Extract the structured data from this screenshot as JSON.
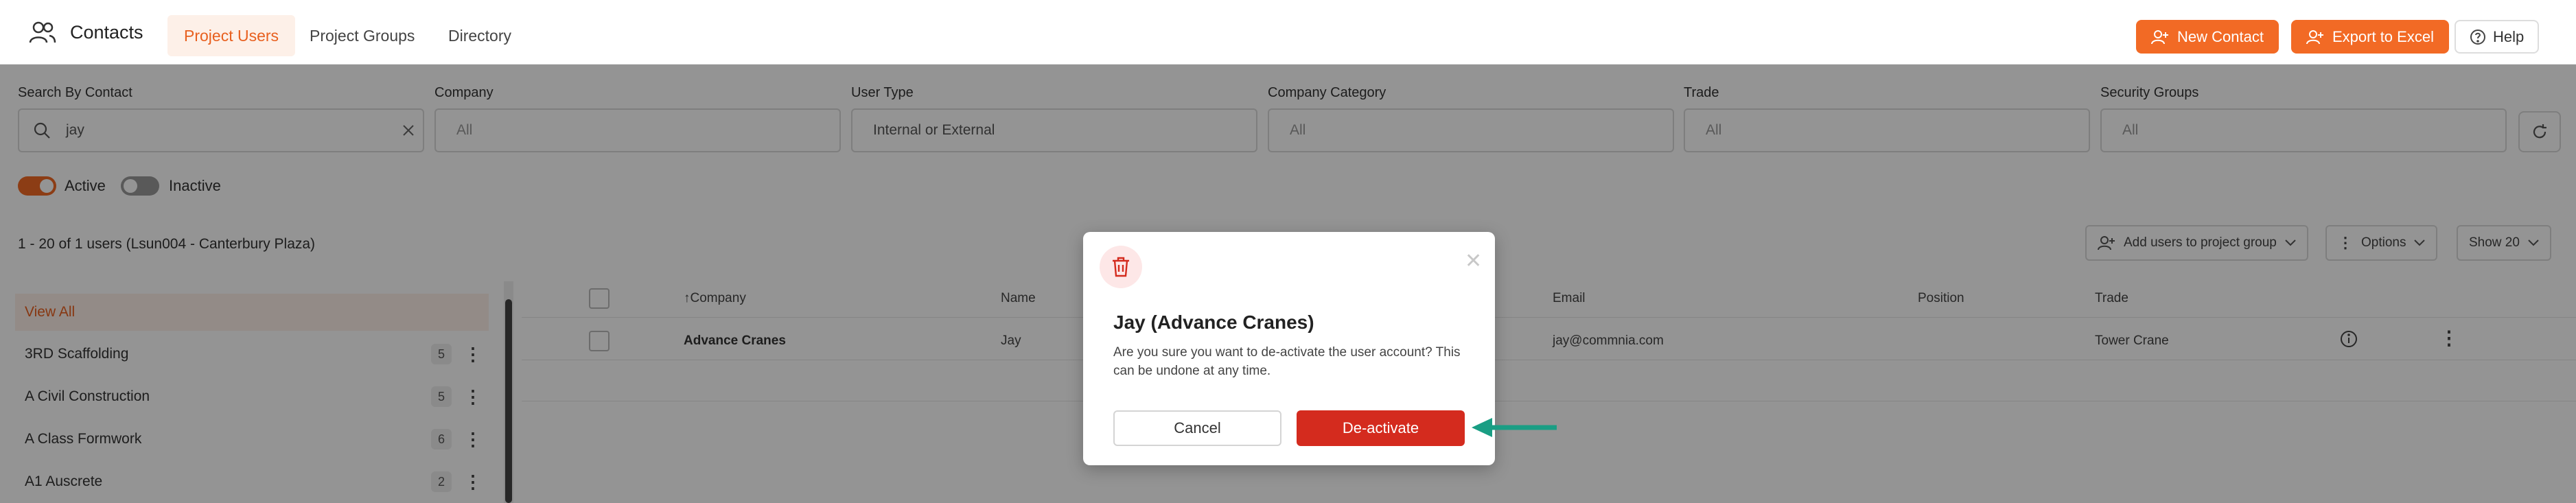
{
  "header": {
    "app_title": "Contacts",
    "tabs": [
      {
        "label": "Project Users",
        "active": true
      },
      {
        "label": "Project Groups",
        "active": false
      },
      {
        "label": "Directory",
        "active": false
      }
    ],
    "new_contact_label": "New Contact",
    "export_label": "Export to Excel",
    "help_label": "Help"
  },
  "filters": {
    "search": {
      "label": "Search By Contact",
      "value": "jay"
    },
    "company": {
      "label": "Company",
      "placeholder": "All"
    },
    "user_type": {
      "label": "User Type",
      "value": "Internal or External"
    },
    "company_category": {
      "label": "Company Category",
      "placeholder": "All"
    },
    "trade": {
      "label": "Trade",
      "placeholder": "All"
    },
    "security_groups": {
      "label": "Security Groups",
      "placeholder": "All"
    },
    "active_label": "Active",
    "inactive_label": "Inactive",
    "active_on": true,
    "inactive_on": false
  },
  "list": {
    "count_text": "1 - 20 of 1 users (Lsun004 - Canterbury Plaza)",
    "add_to_group_label": "Add users to project group",
    "options_label": "Options",
    "show_label": "Show 20"
  },
  "sidebar": {
    "items": [
      {
        "label": "View All",
        "count": "",
        "active": true
      },
      {
        "label": "3RD Scaffolding",
        "count": "5"
      },
      {
        "label": "A Civil Construction",
        "count": "5"
      },
      {
        "label": "A Class Formwork",
        "count": "6"
      },
      {
        "label": "A1 Auscrete",
        "count": "2"
      }
    ]
  },
  "table": {
    "columns": {
      "company": "Company",
      "name": "Name",
      "email": "Email",
      "position": "Position",
      "trade": "Trade"
    },
    "rows": [
      {
        "company": "Advance Cranes",
        "name": "Jay",
        "email": "jay@commnia.com",
        "position": "",
        "trade": "Tower Crane"
      }
    ]
  },
  "modal": {
    "title": "Jay (Advance Cranes)",
    "message": "Are you sure you want to de-activate the user account? This can be undone at any time.",
    "cancel_label": "Cancel",
    "confirm_label": "De-activate"
  },
  "colors": {
    "accent": "#f26a25",
    "danger": "#d42b1e",
    "annotation_arrow": "#1a9e84"
  },
  "icons": [
    "contacts-icon",
    "add-user-icon",
    "export-icon",
    "help-icon",
    "search-icon",
    "clear-icon",
    "refresh-icon",
    "add-to-group-icon",
    "kebab-icon",
    "chevron-down-icon",
    "info-icon",
    "trash-icon",
    "close-icon"
  ]
}
